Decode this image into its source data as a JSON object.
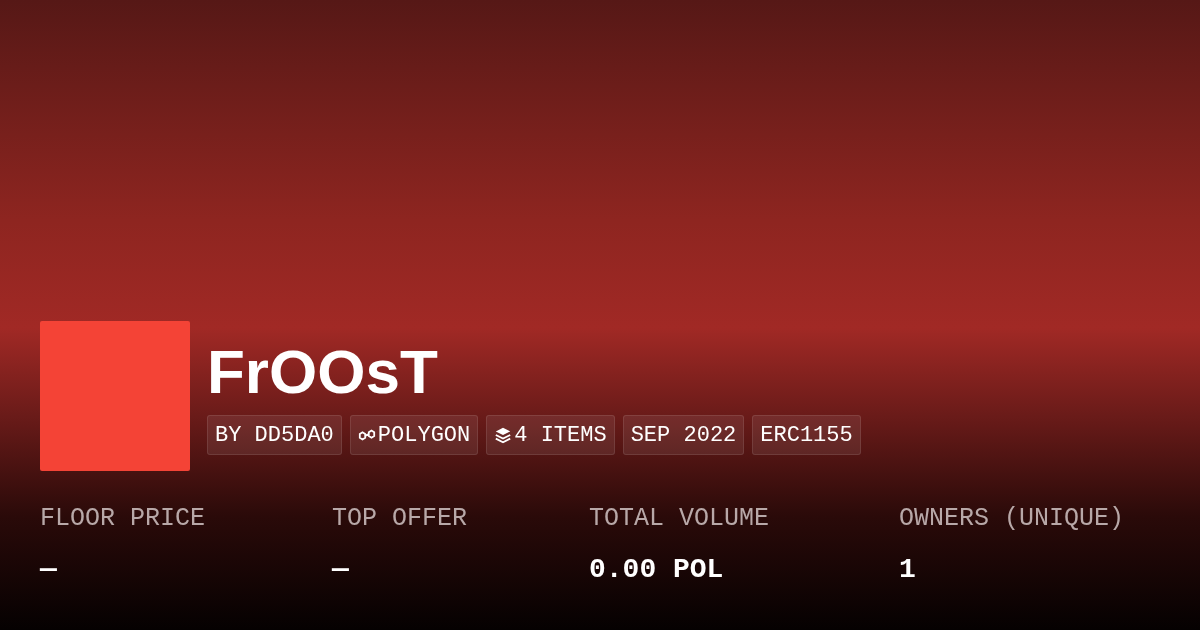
{
  "collection": {
    "name": "FrOOsT",
    "tags": [
      {
        "kind": "text",
        "label": "BY DD5DA0"
      },
      {
        "kind": "chain",
        "label": "POLYGON"
      },
      {
        "kind": "items",
        "label": "4 ITEMS"
      },
      {
        "kind": "text",
        "label": "SEP 2022"
      },
      {
        "kind": "text",
        "label": "ERC1155"
      }
    ]
  },
  "stats": [
    {
      "label": "FLOOR PRICE",
      "value": "—"
    },
    {
      "label": "TOP OFFER",
      "value": "—"
    },
    {
      "label": "TOTAL VOLUME",
      "value": "0.00 POL"
    },
    {
      "label": "OWNERS (UNIQUE)",
      "value": "1"
    }
  ]
}
